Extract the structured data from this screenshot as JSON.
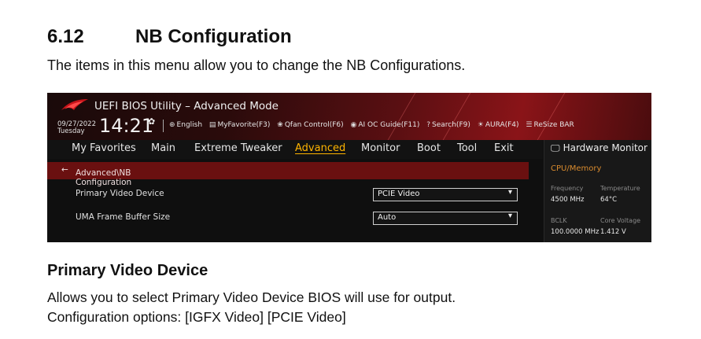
{
  "doc": {
    "section_number": "6.12",
    "section_title": "NB Configuration",
    "intro": "The items in this menu allow you to change the NB Configurations.",
    "subsection_title": "Primary Video Device",
    "desc_line1": "Allows you to select Primary Video Device BIOS will use for output.",
    "desc_line2": "Configuration options: [IGFX Video] [PCIE Video]"
  },
  "bios": {
    "title": "UEFI BIOS Utility – Advanced Mode",
    "date": "09/27/2022",
    "day": "Tuesday",
    "time": "14:21",
    "toolbar": [
      {
        "icon": "globe-icon",
        "glyph": "⊕",
        "label": "English"
      },
      {
        "icon": "favorites-icon",
        "glyph": "▤",
        "label": "MyFavorite(F3)"
      },
      {
        "icon": "fan-icon",
        "glyph": "❀",
        "label": "Qfan Control(F6)"
      },
      {
        "icon": "ai-guide-icon",
        "glyph": "◉",
        "label": "AI OC Guide(F11)"
      },
      {
        "icon": "search-icon",
        "glyph": "?",
        "label": "Search(F9)"
      },
      {
        "icon": "aura-icon",
        "glyph": "☀",
        "label": "AURA(F4)"
      },
      {
        "icon": "resize-bar-icon",
        "glyph": "☰",
        "label": "ReSize BAR"
      }
    ],
    "menu": [
      "My Favorites",
      "Main",
      "Extreme Tweaker",
      "Advanced",
      "Monitor",
      "Boot",
      "Tool",
      "Exit"
    ],
    "active_menu": "Advanced",
    "accent_color": "#ffb400",
    "breadcrumb": "Advanced\\NB Configuration",
    "settings": [
      {
        "label": "Primary Video Device",
        "value": "PCIE Video"
      },
      {
        "label": "UMA Frame Buffer Size",
        "value": "Auto"
      }
    ],
    "hw_monitor": {
      "title": "Hardware Monitor",
      "section": "CPU/Memory",
      "frequency_label": "Frequency",
      "frequency_value": "4500 MHz",
      "temperature_label": "Temperature",
      "temperature_value": "64°C",
      "bclk_label": "BCLK",
      "bclk_value": "100.0000 MHz",
      "core_voltage_label": "Core Voltage",
      "core_voltage_value": "1.412 V"
    }
  }
}
